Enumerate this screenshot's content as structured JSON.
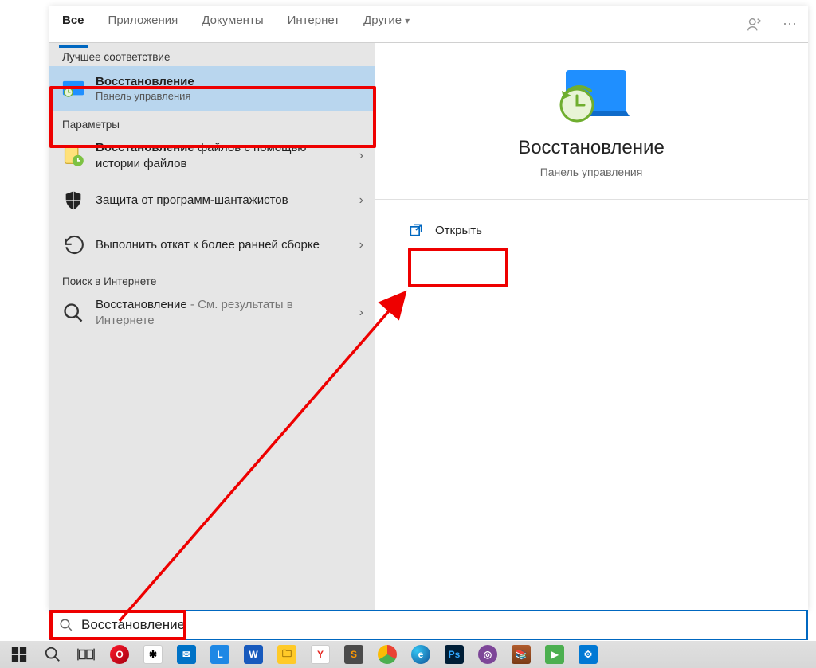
{
  "tabs": {
    "all": "Все",
    "apps": "Приложения",
    "docs": "Документы",
    "web": "Интернет",
    "more": "Другие"
  },
  "sections": {
    "best": "Лучшее соответствие",
    "params": "Параметры",
    "websearch": "Поиск в Интернете"
  },
  "best_result": {
    "title": "Восстановление",
    "subtitle": "Панель управления"
  },
  "params": [
    {
      "title_bold": "Восстановление",
      "title_rest": " файлов с помощью истории файлов"
    },
    {
      "title_bold": "",
      "title_rest": "Защита от программ-шантажистов"
    },
    {
      "title_bold": "",
      "title_rest": "Выполнить откат к более ранней сборке"
    }
  ],
  "websearch_item": {
    "title": "Восстановление",
    "hint": " - См. результаты в Интернете"
  },
  "preview": {
    "title": "Восстановление",
    "subtitle": "Панель управления",
    "open": "Открыть"
  },
  "search": {
    "query": "Восстановление"
  },
  "taskbar": {
    "icons": [
      "start",
      "search",
      "taskview",
      "opera",
      "cursor",
      "mail",
      "lapp",
      "word",
      "explorer",
      "yandex",
      "sublime",
      "chrome",
      "edge",
      "ps",
      "tor",
      "winrar",
      "game",
      "settings"
    ]
  }
}
